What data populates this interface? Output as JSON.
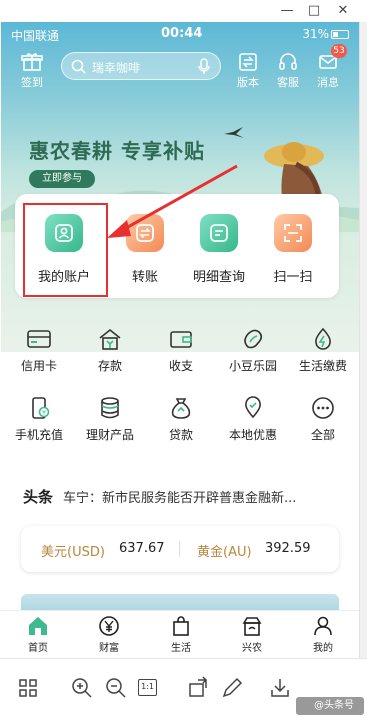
{
  "status_bar": {
    "carrier": "中国联通",
    "time": "00:44",
    "battery": "31%"
  },
  "top_nav": {
    "checkin_label": "签到",
    "search_placeholder": "瑞幸咖啡",
    "version_label": "版本",
    "service_label": "客服",
    "message_label": "消息",
    "message_badge": "53"
  },
  "banner": {
    "title": "惠农春耕  专享补贴",
    "cta_label": "立即参与"
  },
  "quick_actions": [
    {
      "label": "我的账户",
      "icon": "user-card-icon"
    },
    {
      "label": "转账",
      "icon": "transfer-icon"
    },
    {
      "label": "明细查询",
      "icon": "list-icon"
    },
    {
      "label": "扫一扫",
      "icon": "scan-icon"
    }
  ],
  "services": [
    {
      "label": "信用卡",
      "icon": "credit-card-icon"
    },
    {
      "label": "存款",
      "icon": "deposit-house-icon"
    },
    {
      "label": "收支",
      "icon": "wallet-icon"
    },
    {
      "label": "小豆乐园",
      "icon": "bean-icon"
    },
    {
      "label": "生活缴费",
      "icon": "bolt-drop-icon"
    },
    {
      "label": "手机充值",
      "icon": "phone-recharge-icon"
    },
    {
      "label": "理财产品",
      "icon": "coins-stack-icon"
    },
    {
      "label": "贷款",
      "icon": "loan-bag-icon"
    },
    {
      "label": "本地优惠",
      "icon": "location-pin-icon"
    },
    {
      "label": "全部",
      "icon": "more-dots-icon"
    }
  ],
  "news": {
    "tag": "头条",
    "headline": "车宁：新市民服务能否开辟普惠金融新..."
  },
  "rates": [
    {
      "label": "美元(USD)",
      "value": "637.67"
    },
    {
      "label": "黄金(AU)",
      "value": "392.59"
    }
  ],
  "tab_bar": [
    {
      "label": "首页",
      "icon": "home-icon"
    },
    {
      "label": "财富",
      "icon": "yuan-circle-icon"
    },
    {
      "label": "生活",
      "icon": "shopping-bag-icon"
    },
    {
      "label": "兴农",
      "icon": "farm-shop-icon"
    },
    {
      "label": "我的",
      "icon": "person-icon"
    }
  ],
  "viewer_toolbar": {
    "zoom_label": "1:1"
  },
  "watermark": "@头条号"
}
